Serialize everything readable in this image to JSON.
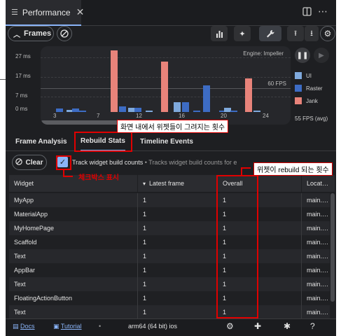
{
  "title_bar": {
    "tab_label": "Performance"
  },
  "toolbar": {
    "frames_label": "Frames"
  },
  "chart_data": {
    "type": "bar",
    "yticks": [
      "27 ms",
      "17 ms",
      "7 ms",
      "0 ms"
    ],
    "xticks": [
      "3",
      "7",
      "12",
      "16",
      "20",
      "24"
    ],
    "engine_label": "Engine: Impeller",
    "fps_line_label": "60 FPS",
    "series": [
      {
        "name": "UI",
        "color": "#7fa9dc"
      },
      {
        "name": "Raster",
        "color": "#3d6cc4"
      },
      {
        "name": "Jank",
        "color": "#e8837a"
      }
    ],
    "fps_avg": "55 FPS (avg)"
  },
  "tabs": {
    "frame_analysis": "Frame Analysis",
    "rebuild_stats": "Rebuild Stats",
    "timeline_events": "Timeline Events"
  },
  "rebuild": {
    "clear_label": "Clear",
    "checked": true,
    "track_label": "Track widget build counts",
    "track_desc": " • Tracks widget build counts for e"
  },
  "table": {
    "columns": [
      "Widget",
      "Latest frame",
      "Overall",
      "Locat…"
    ],
    "rows": [
      [
        "MyApp",
        "1",
        "1",
        "main.…"
      ],
      [
        "MaterialApp",
        "1",
        "1",
        "main.…"
      ],
      [
        "MyHomePage",
        "1",
        "1",
        "main.…"
      ],
      [
        "Scaffold",
        "1",
        "1",
        "main.…"
      ],
      [
        "Text",
        "1",
        "1",
        "main.…"
      ],
      [
        "AppBar",
        "1",
        "1",
        "main.…"
      ],
      [
        "Text",
        "1",
        "1",
        "main.…"
      ],
      [
        "FloatingActionButton",
        "1",
        "1",
        "main.…"
      ],
      [
        "Text",
        "1",
        "1",
        "main.…"
      ]
    ]
  },
  "footer": {
    "docs": "Docs",
    "tutorial": "Tutorial",
    "device": "arm64 (64 bit) ios"
  },
  "annotations": {
    "rebuild_stats_note": "화면 내에서 위젯들이 그려지는 횟수",
    "checkbox_note": "체크박스 표시",
    "overall_note": "위젯이 rebuild 되는 횟수"
  }
}
